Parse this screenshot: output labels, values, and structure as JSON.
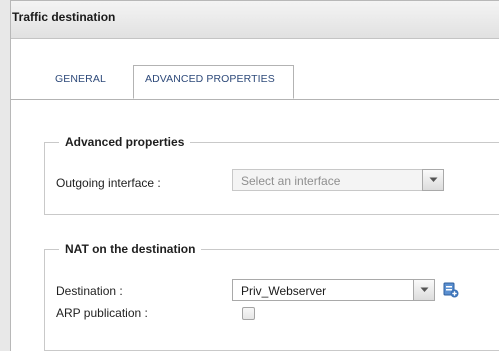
{
  "panel": {
    "title": "Traffic destination"
  },
  "tabs": [
    {
      "label": "GENERAL",
      "active": false
    },
    {
      "label": "ADVANCED PROPERTIES",
      "active": true
    }
  ],
  "advanced": {
    "legend": "Advanced properties",
    "outgoing_label": "Outgoing interface :",
    "outgoing_value": "Select an interface",
    "outgoing_disabled": true
  },
  "nat": {
    "legend": "NAT on the destination",
    "destination_label": "Destination :",
    "destination_value": "Priv_Webserver",
    "arp_label": "ARP publication :",
    "arp_checked": false,
    "arp_disabled": true
  },
  "icons": {
    "dropdown": "chevron-down-icon",
    "add_object": "add-object-icon"
  },
  "colors": {
    "tab_text": "#2e4a7a",
    "accent_blue": "#3b73b9"
  }
}
